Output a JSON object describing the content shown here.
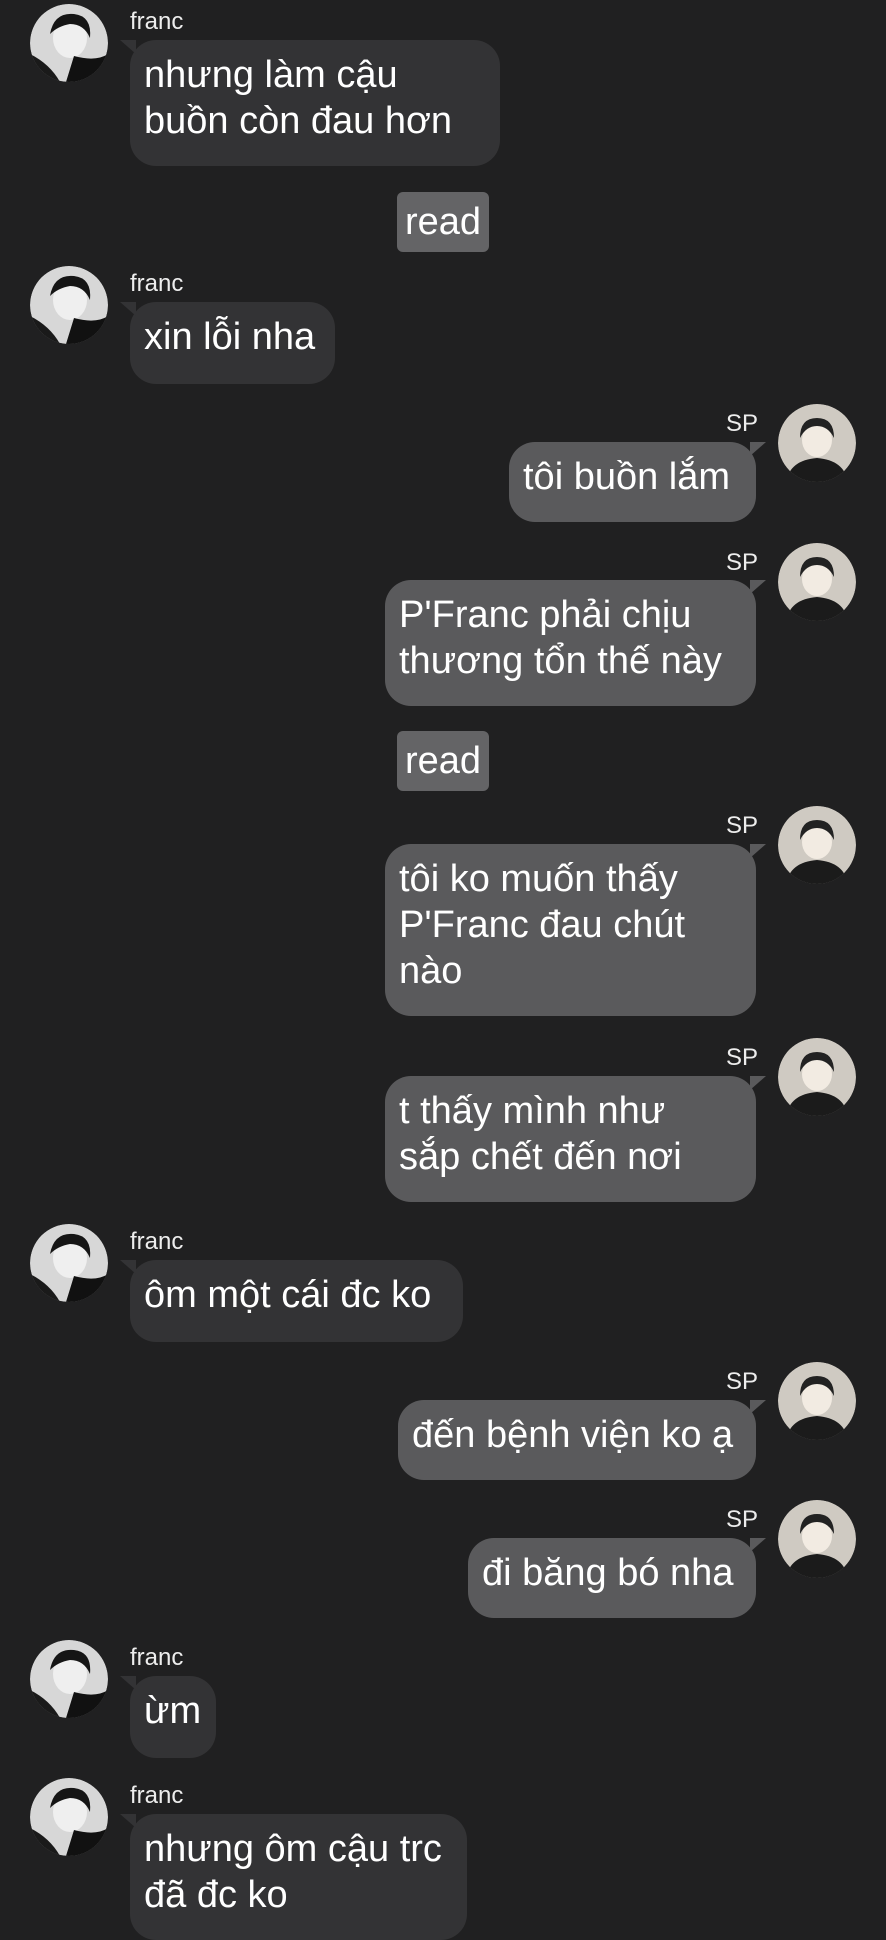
{
  "participants": {
    "them": "franc",
    "me": "SP"
  },
  "messages": [
    {
      "sender": "franc",
      "text": "nhưng làm cậu\nbuồn còn đau hơn"
    },
    {
      "read": "read"
    },
    {
      "sender": "franc",
      "text": "xin lỗi nha"
    },
    {
      "sender": "SP",
      "text": "tôi buồn lắm"
    },
    {
      "sender": "SP",
      "text": "P'Franc phải chịu\nthương tổn thế này"
    },
    {
      "read": "read"
    },
    {
      "sender": "SP",
      "text": "tôi ko muốn thấy\nP'Franc đau chút\nnào"
    },
    {
      "sender": "SP",
      "text": "t thấy mình như\nsắp chết đến nơi"
    },
    {
      "sender": "franc",
      "text": "ôm một cái đc ko"
    },
    {
      "sender": "SP",
      "text": "đến bệnh viện ko ạ"
    },
    {
      "sender": "SP",
      "text": "đi băng bó nha"
    },
    {
      "sender": "franc",
      "text": "ừm"
    },
    {
      "sender": "franc",
      "text": "nhưng ôm cậu trc\nđã đc ko"
    }
  ],
  "colors": {
    "background": "#202021",
    "incoming_bubble": "#333335",
    "outgoing_bubble": "#5a5a5c",
    "read_badge": "#646466"
  }
}
